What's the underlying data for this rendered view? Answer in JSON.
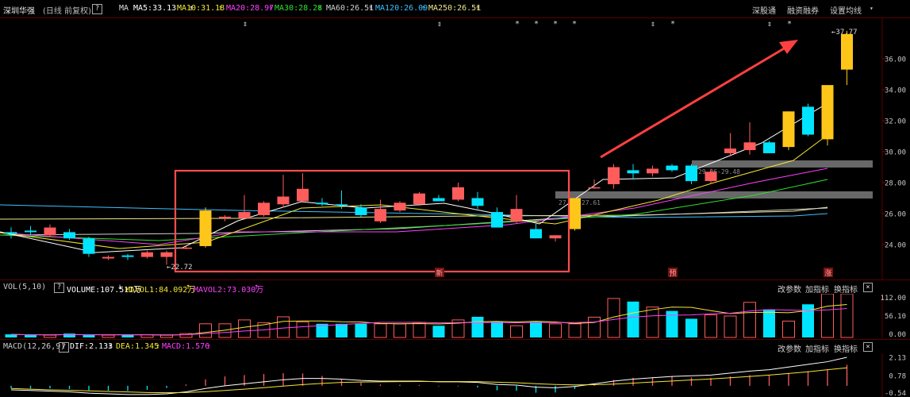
{
  "header": {
    "stock_name": "深圳华强",
    "period": "(日线 前复权)",
    "help": "?",
    "ma_label": "MA",
    "ma": [
      {
        "text": "MA5:33.13",
        "color": "#ffffff",
        "arrow": "↑"
      },
      {
        "text": "MA10:31.18",
        "color": "#f5e532",
        "arrow": "↑"
      },
      {
        "text": "MA20:28.97",
        "color": "#ff40ff",
        "arrow": "↑"
      },
      {
        "text": "MA30:28.28",
        "color": "#2ee02e",
        "arrow": "↑"
      },
      {
        "text": "MA60:26.51",
        "color": "#d0d0d0",
        "arrow": "↑"
      },
      {
        "text": "MA120:26.09",
        "color": "#3cc0ff",
        "arrow": "↑"
      },
      {
        "text": "MA250:26.51",
        "color": "#f0e68c",
        "arrow": "↑"
      }
    ],
    "menu": [
      "深股通",
      "融资融券",
      "设置均线"
    ],
    "menu_arrow": "▾"
  },
  "price_axis": {
    "ticks": [
      "36.00",
      "34.00",
      "32.00",
      "30.00",
      "28.00",
      "26.00",
      "24.00"
    ]
  },
  "annotations": {
    "high_label": "37.77",
    "low_label": "22.72",
    "zone1_label": "29.06-29.48",
    "zone2_label": "27.03-27.61",
    "markers": [
      "新",
      "预",
      "涨"
    ],
    "event_marks": [
      "⇕",
      "⇕",
      "*",
      "*",
      "*",
      "*",
      "⇕",
      "*",
      "⇕",
      "*"
    ]
  },
  "volume": {
    "title": "VOL(5,10)",
    "help": "?",
    "volume": "VOLUME:107.511万",
    "volume_arrow": "↓",
    "mavol1": "MAVOL1:84.092万",
    "mavol1_arrow": "↑",
    "mavol2": "MAVOL2:73.030万",
    "mavol2_arrow": "↑",
    "menu": [
      "改参数",
      "加指标",
      "换指标"
    ],
    "close": "×",
    "ticks": [
      "112.00",
      "56.10",
      "0.00"
    ]
  },
  "macd": {
    "title": "MACD(12,26,9)",
    "help": "?",
    "dif": "DIF:2.133",
    "dif_arrow": "↑",
    "dea": "DEA:1.345",
    "dea_arrow": "↑",
    "macd": "MACD:1.576",
    "macd_arrow": "↑",
    "menu": [
      "改参数",
      "加指标",
      "换指标"
    ],
    "close": "×",
    "ticks": [
      "2.13",
      "0.78",
      "-0.54"
    ]
  },
  "colors": {
    "up": "#ff5c5c",
    "down": "#00e5ff",
    "highlight": "#ffc61a",
    "box": "#ff4d4d",
    "arrow": "#ff4040"
  },
  "chart_data": {
    "type": "candlestick",
    "y_range": [
      22.5,
      38.5
    ],
    "candles": [
      {
        "o": 24.8,
        "h": 25.1,
        "l": 24.4,
        "c": 24.7,
        "d": "down"
      },
      {
        "o": 24.9,
        "h": 25.2,
        "l": 24.6,
        "c": 24.8,
        "d": "down"
      },
      {
        "o": 24.6,
        "h": 25.3,
        "l": 24.5,
        "c": 25.1,
        "d": "up"
      },
      {
        "o": 24.8,
        "h": 25.0,
        "l": 24.3,
        "c": 24.4,
        "d": "down"
      },
      {
        "o": 24.4,
        "h": 24.5,
        "l": 23.2,
        "c": 23.4,
        "d": "down"
      },
      {
        "o": 23.1,
        "h": 23.3,
        "l": 23.0,
        "c": 23.2,
        "d": "up"
      },
      {
        "o": 23.3,
        "h": 23.4,
        "l": 23.0,
        "c": 23.2,
        "d": "down"
      },
      {
        "o": 23.2,
        "h": 23.6,
        "l": 23.1,
        "c": 23.5,
        "d": "up"
      },
      {
        "o": 23.2,
        "h": 23.6,
        "l": 22.7,
        "c": 23.5,
        "d": "up"
      },
      {
        "o": 23.8,
        "h": 23.9,
        "l": 23.7,
        "c": 23.8,
        "d": "up"
      },
      {
        "o": 23.9,
        "h": 26.4,
        "l": 23.8,
        "c": 26.2,
        "d": "hl"
      },
      {
        "o": 25.7,
        "h": 25.9,
        "l": 25.5,
        "c": 25.8,
        "d": "up"
      },
      {
        "o": 25.7,
        "h": 27.2,
        "l": 25.6,
        "c": 26.1,
        "d": "up"
      },
      {
        "o": 25.9,
        "h": 26.8,
        "l": 25.8,
        "c": 26.7,
        "d": "up"
      },
      {
        "o": 26.6,
        "h": 28.5,
        "l": 26.4,
        "c": 27.1,
        "d": "up"
      },
      {
        "o": 26.8,
        "h": 28.6,
        "l": 26.7,
        "c": 27.6,
        "d": "up"
      },
      {
        "o": 26.7,
        "h": 27.0,
        "l": 26.5,
        "c": 26.6,
        "d": "down"
      },
      {
        "o": 26.6,
        "h": 27.5,
        "l": 26.3,
        "c": 26.6,
        "d": "down"
      },
      {
        "o": 26.4,
        "h": 26.6,
        "l": 25.8,
        "c": 25.9,
        "d": "down"
      },
      {
        "o": 25.5,
        "h": 26.9,
        "l": 25.4,
        "c": 26.3,
        "d": "up"
      },
      {
        "o": 26.2,
        "h": 26.8,
        "l": 26.1,
        "c": 26.7,
        "d": "up"
      },
      {
        "o": 26.6,
        "h": 27.4,
        "l": 26.5,
        "c": 27.3,
        "d": "up"
      },
      {
        "o": 27.0,
        "h": 27.2,
        "l": 26.8,
        "c": 26.8,
        "d": "down"
      },
      {
        "o": 26.9,
        "h": 28.0,
        "l": 26.8,
        "c": 27.7,
        "d": "up"
      },
      {
        "o": 27.0,
        "h": 27.4,
        "l": 26.3,
        "c": 26.5,
        "d": "down"
      },
      {
        "o": 26.1,
        "h": 26.4,
        "l": 25.1,
        "c": 25.1,
        "d": "down"
      },
      {
        "o": 25.5,
        "h": 27.2,
        "l": 25.4,
        "c": 26.3,
        "d": "up"
      },
      {
        "o": 25.0,
        "h": 25.4,
        "l": 24.5,
        "c": 24.4,
        "d": "down"
      },
      {
        "o": 24.4,
        "h": 24.6,
        "l": 24.2,
        "c": 24.6,
        "d": "up"
      },
      {
        "o": 25.0,
        "h": 27.0,
        "l": 24.9,
        "c": 27.0,
        "d": "hl"
      },
      {
        "o": 27.7,
        "h": 28.2,
        "l": 27.6,
        "c": 27.7,
        "d": "up"
      },
      {
        "o": 27.9,
        "h": 29.2,
        "l": 27.6,
        "c": 29.0,
        "d": "up"
      },
      {
        "o": 28.6,
        "h": 29.2,
        "l": 28.2,
        "c": 28.8,
        "d": "down"
      },
      {
        "o": 28.6,
        "h": 29.1,
        "l": 28.4,
        "c": 28.9,
        "d": "up"
      },
      {
        "o": 29.1,
        "h": 29.2,
        "l": 28.7,
        "c": 28.8,
        "d": "down"
      },
      {
        "o": 29.1,
        "h": 29.2,
        "l": 27.9,
        "c": 28.1,
        "d": "down"
      },
      {
        "o": 28.1,
        "h": 28.9,
        "l": 27.9,
        "c": 28.7,
        "d": "up"
      },
      {
        "o": 29.9,
        "h": 31.2,
        "l": 29.7,
        "c": 30.2,
        "d": "up"
      },
      {
        "o": 30.1,
        "h": 31.9,
        "l": 29.8,
        "c": 30.6,
        "d": "up"
      },
      {
        "o": 30.6,
        "h": 30.7,
        "l": 29.9,
        "c": 29.9,
        "d": "down"
      },
      {
        "o": 30.3,
        "h": 32.6,
        "l": 30.1,
        "c": 32.6,
        "d": "hl"
      },
      {
        "o": 31.1,
        "h": 33.1,
        "l": 31.0,
        "c": 32.9,
        "d": "down"
      },
      {
        "o": 30.8,
        "h": 34.3,
        "l": 30.4,
        "c": 34.3,
        "d": "hl"
      },
      {
        "o": 35.3,
        "h": 37.8,
        "l": 34.3,
        "c": 37.6,
        "d": "hl"
      }
    ],
    "volume_values": [
      8,
      6,
      6,
      10,
      6,
      6,
      6,
      7,
      6,
      10,
      35,
      35,
      45,
      38,
      53,
      40,
      35,
      35,
      35,
      35,
      35,
      38,
      30,
      45,
      53,
      40,
      30,
      40,
      35,
      35,
      52,
      100,
      92,
      78,
      68,
      48,
      58,
      55,
      90,
      72,
      42,
      85,
      112,
      112
    ],
    "macd_dif": [
      -0.3,
      -0.35,
      -0.4,
      -0.45,
      -0.55,
      -0.6,
      -0.65,
      -0.65,
      -0.6,
      -0.45,
      -0.2,
      0,
      0.15,
      0.3,
      0.45,
      0.55,
      0.55,
      0.5,
      0.4,
      0.35,
      0.35,
      0.35,
      0.3,
      0.3,
      0.25,
      0.1,
      0.05,
      -0.1,
      -0.15,
      -0.05,
      0.15,
      0.35,
      0.5,
      0.6,
      0.7,
      0.75,
      0.8,
      0.95,
      1.1,
      1.2,
      1.4,
      1.6,
      1.8,
      2.13
    ],
    "macd_dea": [
      -0.2,
      -0.25,
      -0.3,
      -0.33,
      -0.38,
      -0.42,
      -0.46,
      -0.5,
      -0.52,
      -0.5,
      -0.44,
      -0.35,
      -0.25,
      -0.14,
      -0.02,
      0.09,
      0.18,
      0.25,
      0.28,
      0.3,
      0.31,
      0.32,
      0.32,
      0.32,
      0.31,
      0.27,
      0.23,
      0.16,
      0.1,
      0.07,
      0.08,
      0.13,
      0.2,
      0.28,
      0.36,
      0.44,
      0.51,
      0.6,
      0.7,
      0.8,
      0.92,
      1.05,
      1.2,
      1.345
    ]
  }
}
